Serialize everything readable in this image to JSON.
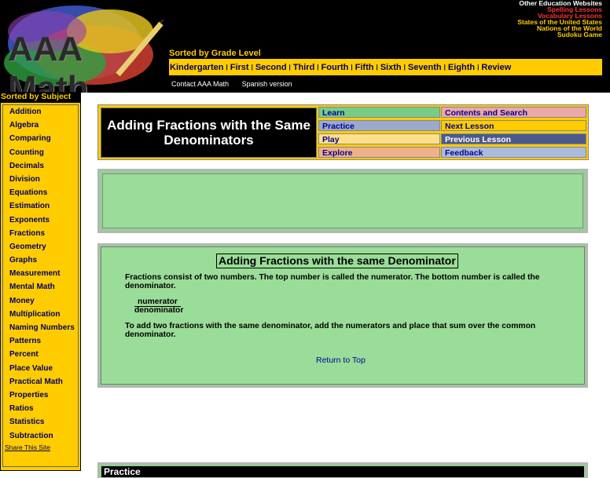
{
  "colors": {
    "header_bg": "#000000",
    "accent_yellow": "#ffcc00",
    "link_blue": "#000099",
    "content_green": "#99dd99",
    "nav_green": "#99cc99",
    "nav_pink": "#eaa8a8",
    "nav_blue": "#99aacc",
    "nav_yellow": "#ffcc00",
    "nav_lightyellow": "#ffe08a",
    "nav_orange": "#f0b08a",
    "nav_slate": "#4a5a8a",
    "nav_lightblue": "#aabbdd"
  },
  "logo": {
    "text": "AAA Math"
  },
  "other_links": [
    {
      "label": "Other Education Websites",
      "color": "#ffffff"
    },
    {
      "label": "Spelling Lessons",
      "color": "#ff3333"
    },
    {
      "label": "Vocabulary Lessons",
      "color": "#ff3333"
    },
    {
      "label": "States of the United States",
      "color": "#ffcc00"
    },
    {
      "label": "Nations of the World",
      "color": "#ffcc00"
    },
    {
      "label": "Sudoku Game",
      "color": "#ffcc00"
    }
  ],
  "grade": {
    "heading": "Sorted by Grade Level",
    "items": [
      "Kindergarten",
      "First",
      "Second",
      "Third",
      "Fourth",
      "Fifth",
      "Sixth",
      "Seventh",
      "Eighth",
      "Review"
    ]
  },
  "contact": {
    "contact_label": "Contact AAA Math",
    "spanish_label": "Spanish version"
  },
  "sidebar": {
    "heading": "Sorted by Subject",
    "items": [
      "Addition",
      "Algebra",
      "Comparing",
      "Counting",
      "Decimals",
      "Division",
      "Equations",
      "Estimation",
      "Exponents",
      "Fractions",
      "Geometry",
      "Graphs",
      "Measurement",
      "Mental Math",
      "Money",
      "Multiplication",
      "Naming Numbers",
      "Patterns",
      "Percent",
      "Place Value",
      "Practical Math",
      "Properties",
      "Ratios",
      "Statistics",
      "Subtraction"
    ],
    "share": "Share This Site"
  },
  "title_box": {
    "title": "Adding Fractions with the Same Denominators"
  },
  "nav": {
    "learn": "Learn",
    "practice": "Practice",
    "play": "Play",
    "explore": "Explore",
    "contents": "Contents and Search",
    "next": "Next Lesson",
    "previous": "Previous Lesson",
    "feedback": "Feedback"
  },
  "lesson": {
    "title": "Adding Fractions with the same Denominator",
    "para1": "Fractions consist of two numbers. The top number is called the numerator. The bottom number is called the denominator.",
    "numerator": "numerator",
    "denominator": "denominator",
    "para2": "To add two fractions with the same denominator, add the numerators and place that sum over the common denominator.",
    "return_top": "Return to Top"
  },
  "practice": {
    "label": "Practice"
  }
}
